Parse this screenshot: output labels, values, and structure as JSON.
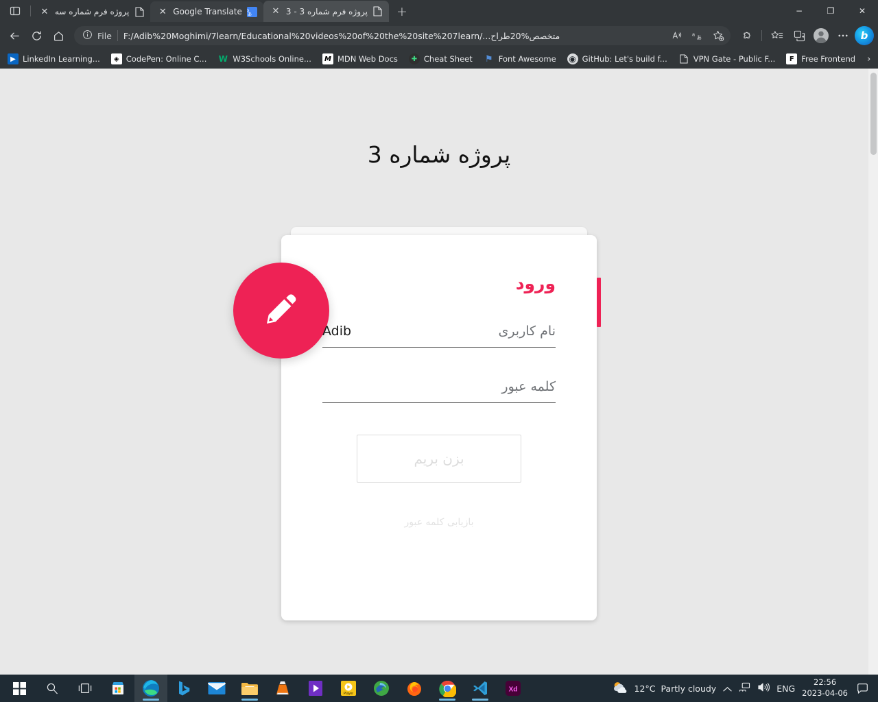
{
  "browser": {
    "tab_strip": {
      "tab_search_icon": "tab-search-icon",
      "new_tab_label": "+",
      "tabs": [
        {
          "title": "پروژه فرم شماره سه",
          "favicon": "document-icon",
          "active": false,
          "close_label": "✕"
        },
        {
          "title": "Google Translate",
          "favicon": "google-translate-icon",
          "active": false,
          "close_label": "✕"
        },
        {
          "title": "پروژه فرم شماره 3 - 3",
          "favicon": "document-icon",
          "active": true,
          "close_label": "✕"
        }
      ]
    },
    "window_controls": {
      "minimize": "−",
      "maximize": "❐",
      "close": "✕"
    },
    "toolbar": {
      "back_label": "back-arrow-icon",
      "reload_label": "reload-icon",
      "home_label": "home-icon",
      "scheme_label": "File",
      "info_icon": "info-circle-icon",
      "url": "F:/Adib%20Moghimi/7learn/Educational%20videos%20of%20the%20site%207learn/...متخصص%20طراح",
      "read_aloud_icon": "read-aloud-icon",
      "translate_icon": "translate-icon",
      "add_favorite_icon": "add-favorite-star-icon",
      "extensions_icon": "extensions-puzzle-icon",
      "collections_icon": "collections-icon",
      "split_screen_icon": "split-screen-icon",
      "profile_icon": "profile-avatar-icon",
      "settings_icon": "more-ellipsis-icon",
      "copilot_label": "b"
    },
    "bookmarks": [
      {
        "label": "LinkedIn Learning...",
        "icon": "linkedin-learning-icon",
        "color": "#0a66c2",
        "glyph": "▶"
      },
      {
        "label": "CodePen: Online C...",
        "icon": "codepen-icon",
        "color": "#ffffff",
        "glyph": "◈"
      },
      {
        "label": "W3Schools Online...",
        "icon": "w3schools-icon",
        "color": "#04aa6d",
        "glyph": "W"
      },
      {
        "label": "MDN Web Docs",
        "icon": "mdn-icon",
        "color": "#000000",
        "glyph": "M"
      },
      {
        "label": "Cheat Sheet",
        "icon": "cheat-sheet-icon",
        "color": "#2f2f2f",
        "glyph": "✚"
      },
      {
        "label": "Font Awesome",
        "icon": "font-awesome-icon",
        "color": "#538dd7",
        "glyph": "⚑"
      },
      {
        "label": "GitHub: Let's build f...",
        "icon": "github-icon",
        "color": "#24292e",
        "glyph": "●"
      },
      {
        "label": "VPN Gate - Public F...",
        "icon": "document-icon",
        "color": "#ffffff",
        "glyph": "🗋"
      },
      {
        "label": "Free Frontend",
        "icon": "free-frontend-icon",
        "color": "#111111",
        "glyph": "F"
      }
    ],
    "bookmarks_overflow_label": "›"
  },
  "page": {
    "heading": "پروژه شماره 3",
    "card": {
      "title": "ورود",
      "badge_icon": "pencil-icon",
      "accent_color": "#ee2255",
      "fields": [
        {
          "label": "نام کاربری",
          "value": "Adib",
          "name": "username"
        },
        {
          "label": "کلمه عبور",
          "value": "",
          "name": "password"
        }
      ],
      "submit_label": "بزن بریم",
      "recover_label": "بازیابی کلمه عبور"
    }
  },
  "taskbar": {
    "items": [
      {
        "name": "start-button",
        "icon": "windows-logo-icon"
      },
      {
        "name": "search-button",
        "icon": "search-icon"
      },
      {
        "name": "task-view-button",
        "icon": "task-view-icon"
      },
      {
        "name": "microsoft-store",
        "icon": "microsoft-store-icon"
      },
      {
        "name": "microsoft-edge",
        "icon": "edge-icon"
      },
      {
        "name": "bing-chat",
        "icon": "bing-icon"
      },
      {
        "name": "mail",
        "icon": "mail-icon"
      },
      {
        "name": "file-explorer",
        "icon": "folder-icon"
      },
      {
        "name": "vlc-media-player",
        "icon": "vlc-cone-icon"
      },
      {
        "name": "movies-and-tv",
        "icon": "movies-tv-icon"
      },
      {
        "name": "media-player",
        "icon": "media-player-icon"
      },
      {
        "name": "internet-download-manager",
        "icon": "idm-icon"
      },
      {
        "name": "firefox",
        "icon": "firefox-icon"
      },
      {
        "name": "google-chrome",
        "icon": "chrome-icon"
      },
      {
        "name": "visual-studio-code",
        "icon": "vscode-icon"
      },
      {
        "name": "adobe-xd",
        "icon": "adobe-xd-icon"
      }
    ],
    "tray": {
      "weather_temp": "12°C",
      "weather_desc": "Partly cloudy",
      "weather_icon": "partly-cloudy-icon",
      "overflow_icon": "show-hidden-icons-chevron",
      "network_icon": "network-icon",
      "volume_icon": "volume-icon",
      "language": "ENG",
      "time": "22:56",
      "date": "2023-04-06",
      "notification_icon": "notification-center-icon"
    }
  }
}
